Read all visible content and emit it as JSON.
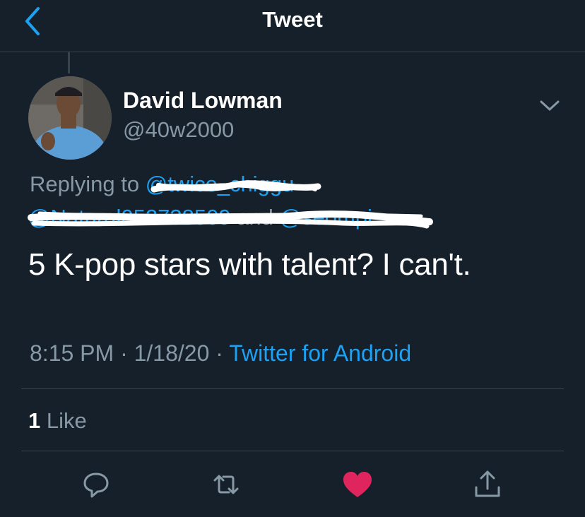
{
  "header": {
    "title": "Tweet",
    "back_icon": "chevron-left-icon"
  },
  "author": {
    "name": "David Lowman",
    "handle": "@40w2000",
    "avatar": "avatar-photo"
  },
  "reply": {
    "label": "Replying to",
    "mention_1": "@twice_chiggu",
    "mention_2": "@Natural052738509",
    "and_text": " and ",
    "mention_3": "@seompi"
  },
  "tweet": {
    "text": "5 K-pop stars with talent? I can't.",
    "time": "8:15 PM",
    "separator": " · ",
    "date": "1/18/20",
    "source": "Twitter for Android"
  },
  "stats": {
    "like_count": "1",
    "like_label": "Like"
  },
  "actions": {
    "reply_icon": "reply-icon",
    "retweet_icon": "retweet-icon",
    "like_icon": "heart-icon",
    "share_icon": "share-icon"
  },
  "colors": {
    "background": "#15202b",
    "accent": "#1da1f2",
    "secondary_text": "#8899a6",
    "like_active": "#e0245e",
    "divider": "#38444d"
  }
}
